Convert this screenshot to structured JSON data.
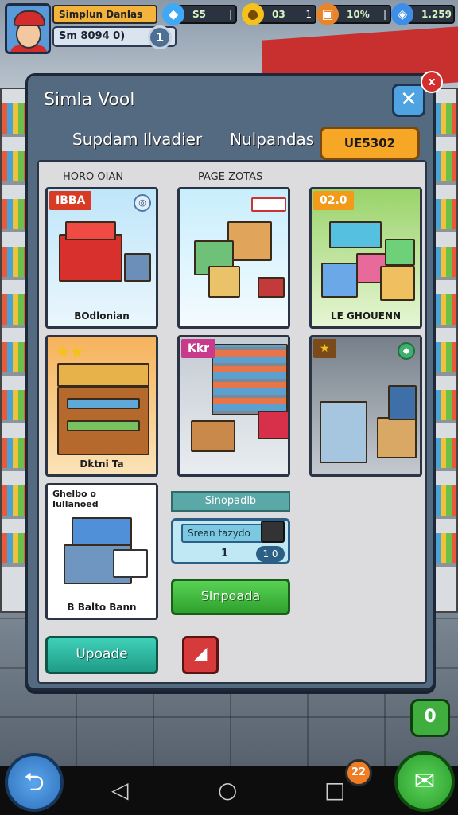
{
  "hud": {
    "player_name": "Simplun Danlas",
    "player_stat": "Sm 8094 0)",
    "level": "1",
    "resources": [
      {
        "icon": "gem-icon",
        "value": "S5",
        "color": "#3fa9f5"
      },
      {
        "icon": "gold-coin-icon",
        "value": "03",
        "color": "#f4c21a"
      },
      {
        "icon": "crate-icon",
        "value": "10%",
        "color": "#e8842a"
      },
      {
        "icon": "diamond-icon",
        "value": "1.259",
        "color": "#3e8ee8"
      }
    ]
  },
  "panel": {
    "title": "Simla Vool",
    "close_symbol": "✕",
    "close_badge": "x",
    "tabs": [
      "Supdam Ilvadier",
      "Nulpandas"
    ],
    "tab_button": "UE5302",
    "col_headers": [
      "HORO OIAN",
      "PAGE ZOTAS"
    ]
  },
  "cards": [
    {
      "tag": "IBBA",
      "caption": "BOdlonian",
      "corner": "◎"
    },
    {
      "tag": "",
      "caption": "",
      "corner": ""
    },
    {
      "tag": "02.0",
      "caption": "LE GHOUENN",
      "corner": ""
    },
    {
      "tag": "★★",
      "caption": "Dktni Ta",
      "corner": ""
    },
    {
      "tag": "Kkr",
      "caption": "",
      "corner": ""
    },
    {
      "tag": "★",
      "caption": "",
      "corner": "◆"
    },
    {
      "tag": "Ghelbo o Iullanoed",
      "caption": "B Balto Bann",
      "corner": ""
    }
  ],
  "controls": {
    "sub_header": "Sinopadlb",
    "input_label": "Srean tazydo",
    "input_count": "1",
    "input_pill": "1 0",
    "green_button": "Slnpoada",
    "teal_button": "Upoade",
    "red_button": "◢"
  },
  "bottom": {
    "side_button": "0",
    "notification_count": "22",
    "nav_back": "◁",
    "nav_home": "○",
    "nav_recent": "□",
    "left_button": "⮌",
    "right_button": "✉"
  }
}
